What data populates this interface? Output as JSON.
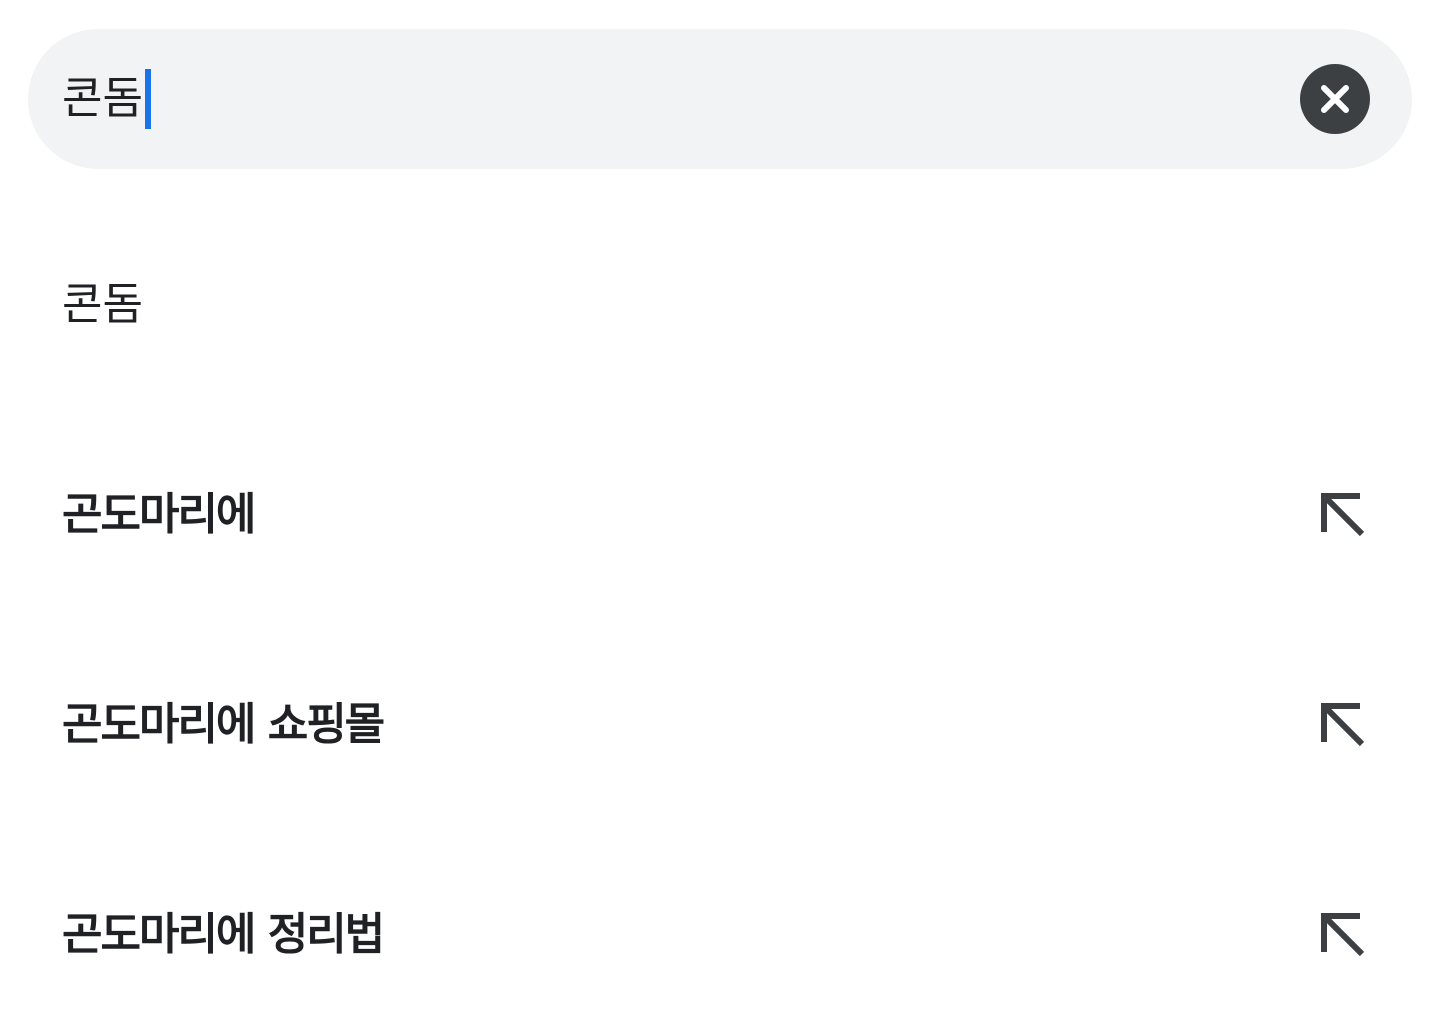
{
  "search": {
    "value": "콘돔",
    "clear_icon": "close-icon"
  },
  "suggestions": [
    {
      "label": "콘돔",
      "bold": false,
      "fill_icon": null
    },
    {
      "label": "곤도마리에",
      "bold": true,
      "fill_icon": "arrow-up-left-icon"
    },
    {
      "label": "곤도마리에 쇼핑몰",
      "bold": true,
      "fill_icon": "arrow-up-left-icon"
    },
    {
      "label": "곤도마리에 정리법",
      "bold": true,
      "fill_icon": "arrow-up-left-icon"
    }
  ],
  "colors": {
    "search_bg": "#f1f3f4",
    "caret": "#1a73e8",
    "text": "#202124",
    "icon": "#3c4043"
  }
}
